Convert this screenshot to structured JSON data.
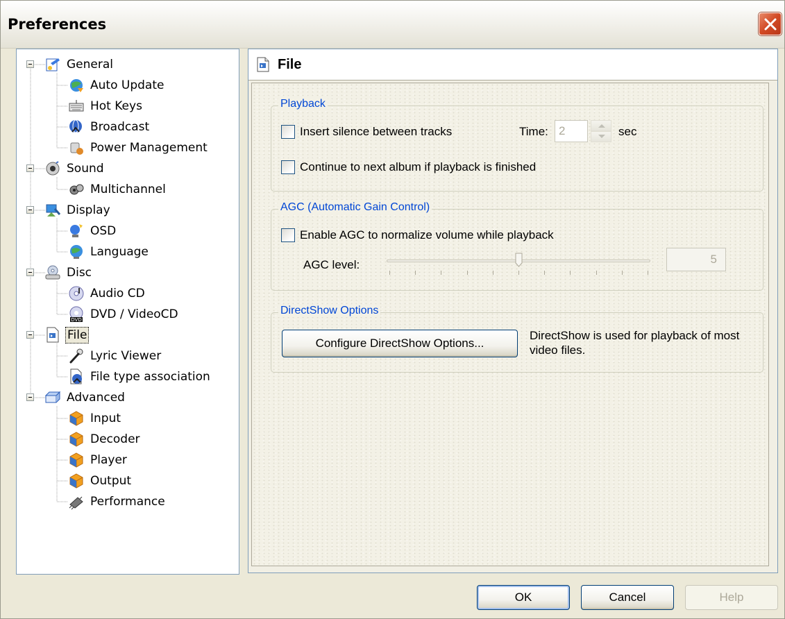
{
  "window": {
    "title": "Preferences"
  },
  "tree": {
    "nodes": [
      {
        "label": "General",
        "icon": "general-settings-icon",
        "expanded": true
      },
      {
        "label": "Auto Update",
        "icon": "globe-update-icon"
      },
      {
        "label": "Hot Keys",
        "icon": "keyboard-icon"
      },
      {
        "label": "Broadcast",
        "icon": "broadcast-icon"
      },
      {
        "label": "Power Management",
        "icon": "power-plug-icon"
      },
      {
        "label": "Sound",
        "icon": "speaker-icon",
        "expanded": true
      },
      {
        "label": "Multichannel",
        "icon": "multichannel-speakers-icon"
      },
      {
        "label": "Display",
        "icon": "monitor-icon",
        "expanded": true
      },
      {
        "label": "OSD",
        "icon": "osd-icon"
      },
      {
        "label": "Language",
        "icon": "globe-icon"
      },
      {
        "label": "Disc",
        "icon": "disc-drive-icon",
        "expanded": true
      },
      {
        "label": "Audio CD",
        "icon": "audio-cd-icon"
      },
      {
        "label": "DVD / VideoCD",
        "icon": "dvd-icon"
      },
      {
        "label": "File",
        "icon": "file-icon",
        "expanded": true,
        "selected": true
      },
      {
        "label": "Lyric Viewer",
        "icon": "microphone-icon"
      },
      {
        "label": "File type association",
        "icon": "file-association-icon"
      },
      {
        "label": "Advanced",
        "icon": "advanced-folder-icon",
        "expanded": true
      },
      {
        "label": "Input",
        "icon": "cube-icon"
      },
      {
        "label": "Decoder",
        "icon": "cube-icon"
      },
      {
        "label": "Player",
        "icon": "cube-icon"
      },
      {
        "label": "Output",
        "icon": "cube-icon"
      },
      {
        "label": "Performance",
        "icon": "chip-icon"
      }
    ]
  },
  "panel": {
    "title": "File",
    "playback": {
      "legend": "Playback",
      "insert_silence_label": "Insert silence between tracks",
      "insert_silence_checked": false,
      "time_label": "Time:",
      "time_value": "2",
      "time_unit": "sec",
      "continue_label": "Continue to next album if playback is finished",
      "continue_checked": false
    },
    "agc": {
      "legend": "AGC (Automatic Gain Control)",
      "enable_label": "Enable AGC to normalize volume while playback",
      "enable_checked": false,
      "level_label": "AGC level:",
      "level_value": "5",
      "level_fraction": 0.5
    },
    "directshow": {
      "legend": "DirectShow Options",
      "button_label": "Configure DirectShow Options...",
      "description": "DirectShow is used for playback of most video files."
    }
  },
  "buttons": {
    "ok": "OK",
    "cancel": "Cancel",
    "help": "Help"
  },
  "colors": {
    "accent_blue": "#0046d5",
    "close_red": "#d24a24"
  }
}
